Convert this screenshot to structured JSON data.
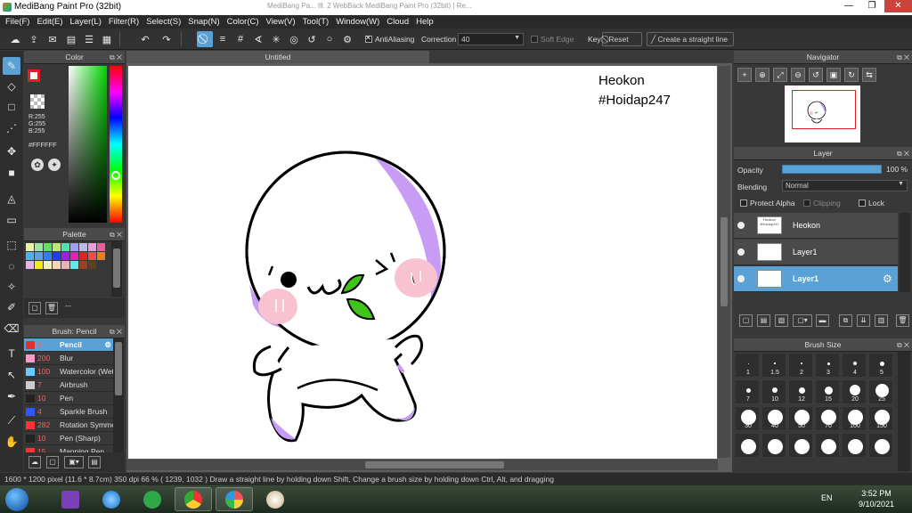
{
  "window": {
    "title": "MediBang Paint Pro (32bit)",
    "behind_text": "MediBang Pa...  Ill. 2 WebBack  MediBang Paint Pro (32bit) | Re...",
    "min_label": "—",
    "max_label": "❐",
    "close_label": "✕"
  },
  "menu": [
    "File(F)",
    "Edit(E)",
    "Layer(L)",
    "Filter(R)",
    "Select(S)",
    "Snap(N)",
    "Color(C)",
    "View(V)",
    "Tool(T)",
    "Window(W)",
    "Cloud",
    "Help"
  ],
  "toolbar": {
    "antialiasing_label": "AntiAliasing",
    "correction_label": "Correction",
    "correction_value": "40",
    "soft_edge_label": "Soft Edge",
    "key_label": "Key",
    "reset_label": "Reset",
    "straight_line_label": "Create a straight line"
  },
  "color_panel": {
    "title": "Color",
    "r": "R:255",
    "g": "G:255",
    "b": "B:255",
    "hex": "#FFFFFF",
    "foreground": "#ffffff",
    "foreground_border": "#e02020"
  },
  "palette": {
    "title": "Palette",
    "colors": [
      "#eaf39e",
      "#9ee89e",
      "#5fe05f",
      "#bde86f",
      "#53e0b3",
      "#9e9ef3",
      "#b9b9e8",
      "#e89ed6",
      "#e85f9e",
      "#49b3f3",
      "#5f9ee8",
      "#2e7ff3",
      "#1f3fe8",
      "#9e1fe8",
      "#e81fb3",
      "#e81f1f",
      "#f34949",
      "#e87f1f",
      "#e8b3e8",
      "#f3e81f",
      "#f3f3b3",
      "#f3d6b3",
      "#e8b3b3",
      "#5fe8e8",
      "#9e3f1f",
      "#5f3f1f",
      "#383838"
    ],
    "dash_label": "---"
  },
  "brush_panel": {
    "title": "Brush: Pencil",
    "items": [
      {
        "size": "4",
        "name": "Pencil",
        "color": "#e03030"
      },
      {
        "size": "200",
        "name": "Blur",
        "color": "#ff99cc"
      },
      {
        "size": "100",
        "name": "Watercolor (Wet)",
        "color": "#66ccff"
      },
      {
        "size": "7",
        "name": "Airbrush",
        "color": "#cccccc"
      },
      {
        "size": "10",
        "name": "Pen",
        "color": "#222222"
      },
      {
        "size": "4",
        "name": "Sparkle Brush",
        "color": "#3355ff"
      },
      {
        "size": "282",
        "name": "Rotation Symmetry",
        "color": "#ff3333"
      },
      {
        "size": "10",
        "name": "Pen (Sharp)",
        "color": "#222222"
      },
      {
        "size": "15",
        "name": "Mapping Pen",
        "color": "#ff3333"
      }
    ]
  },
  "document": {
    "tab": "Untitled",
    "signature_line1": "Heokon",
    "signature_line2": "#Hoidap247"
  },
  "navigator": {
    "title": "Navigator"
  },
  "layer_panel": {
    "title": "Layer",
    "opacity_label": "Opacity",
    "opacity_value": "100 %",
    "opacity_fraction": 1.0,
    "blending_label": "Blending",
    "blending_value": "Normal",
    "protect_alpha_label": "Protect Alpha",
    "clipping_label": "Clipping",
    "lock_label": "Lock",
    "layers": [
      {
        "name": "Heokon",
        "thumb": "Heokon #Hoidap247"
      },
      {
        "name": "Layer1",
        "thumb": ""
      },
      {
        "name": "Layer1",
        "thumb": ""
      }
    ]
  },
  "brush_size_panel": {
    "title": "Brush Size",
    "sizes": [
      "1",
      "1.5",
      "2",
      "3",
      "4",
      "5",
      "7",
      "10",
      "12",
      "15",
      "20",
      "25",
      "30",
      "40",
      "50",
      "70",
      "100",
      "150",
      "",
      "",
      "",
      "",
      "",
      ""
    ]
  },
  "status": {
    "text": "1600 * 1200 pixel   (11.6 * 8.7cm)   350 dpi   66 %   ( 1239, 1032 )   Draw a straight line by holding down Shift, Change a brush size by holding down Ctrl, Alt, and dragging"
  },
  "taskbar": {
    "lang": "EN",
    "time": "3:52 PM",
    "date": "9/10/2021"
  }
}
